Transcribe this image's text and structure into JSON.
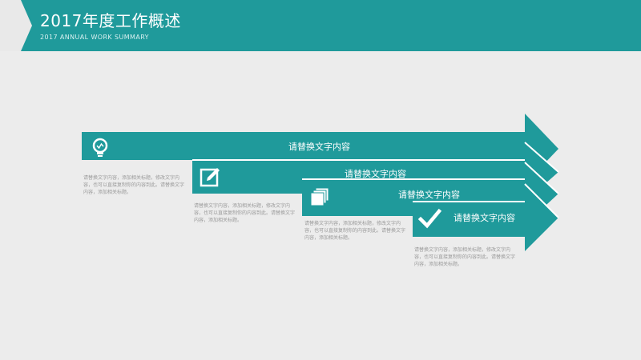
{
  "header": {
    "title": "2017年度工作概述",
    "subtitle": "2017 ANNUAL WORK SUMMARY"
  },
  "colors": {
    "accent": "#1f9a9b",
    "accent_dark": "#16797a",
    "background": "#ececec",
    "body_text": "#9a9a9a"
  },
  "steps": [
    {
      "label": "请替换文字内容",
      "icon": "lightbulb-icon",
      "description": "请替换文字内容，添加相关标题，修改文字内容，也可以直接复制你的内容到此。请替换文字内容，添加相关标题。"
    },
    {
      "label": "请替换文字内容",
      "icon": "edit-icon",
      "description": "请替换文字内容，添加相关标题，修改文字内容，也可以直接复制你的内容到此。请替换文字内容，添加相关标题。"
    },
    {
      "label": "请替换文字内容",
      "icon": "layers-icon",
      "description": "请替换文字内容，添加相关标题，修改文字内容，也可以直接复制你的内容到此。请替换文字内容，添加相关标题。"
    },
    {
      "label": "请替换文字内容",
      "icon": "checkmark-icon",
      "description": "请替换文字内容，添加相关标题，修改文字内容，也可以直接复制你的内容到此。请替换文字内容，添加相关标题。"
    }
  ]
}
